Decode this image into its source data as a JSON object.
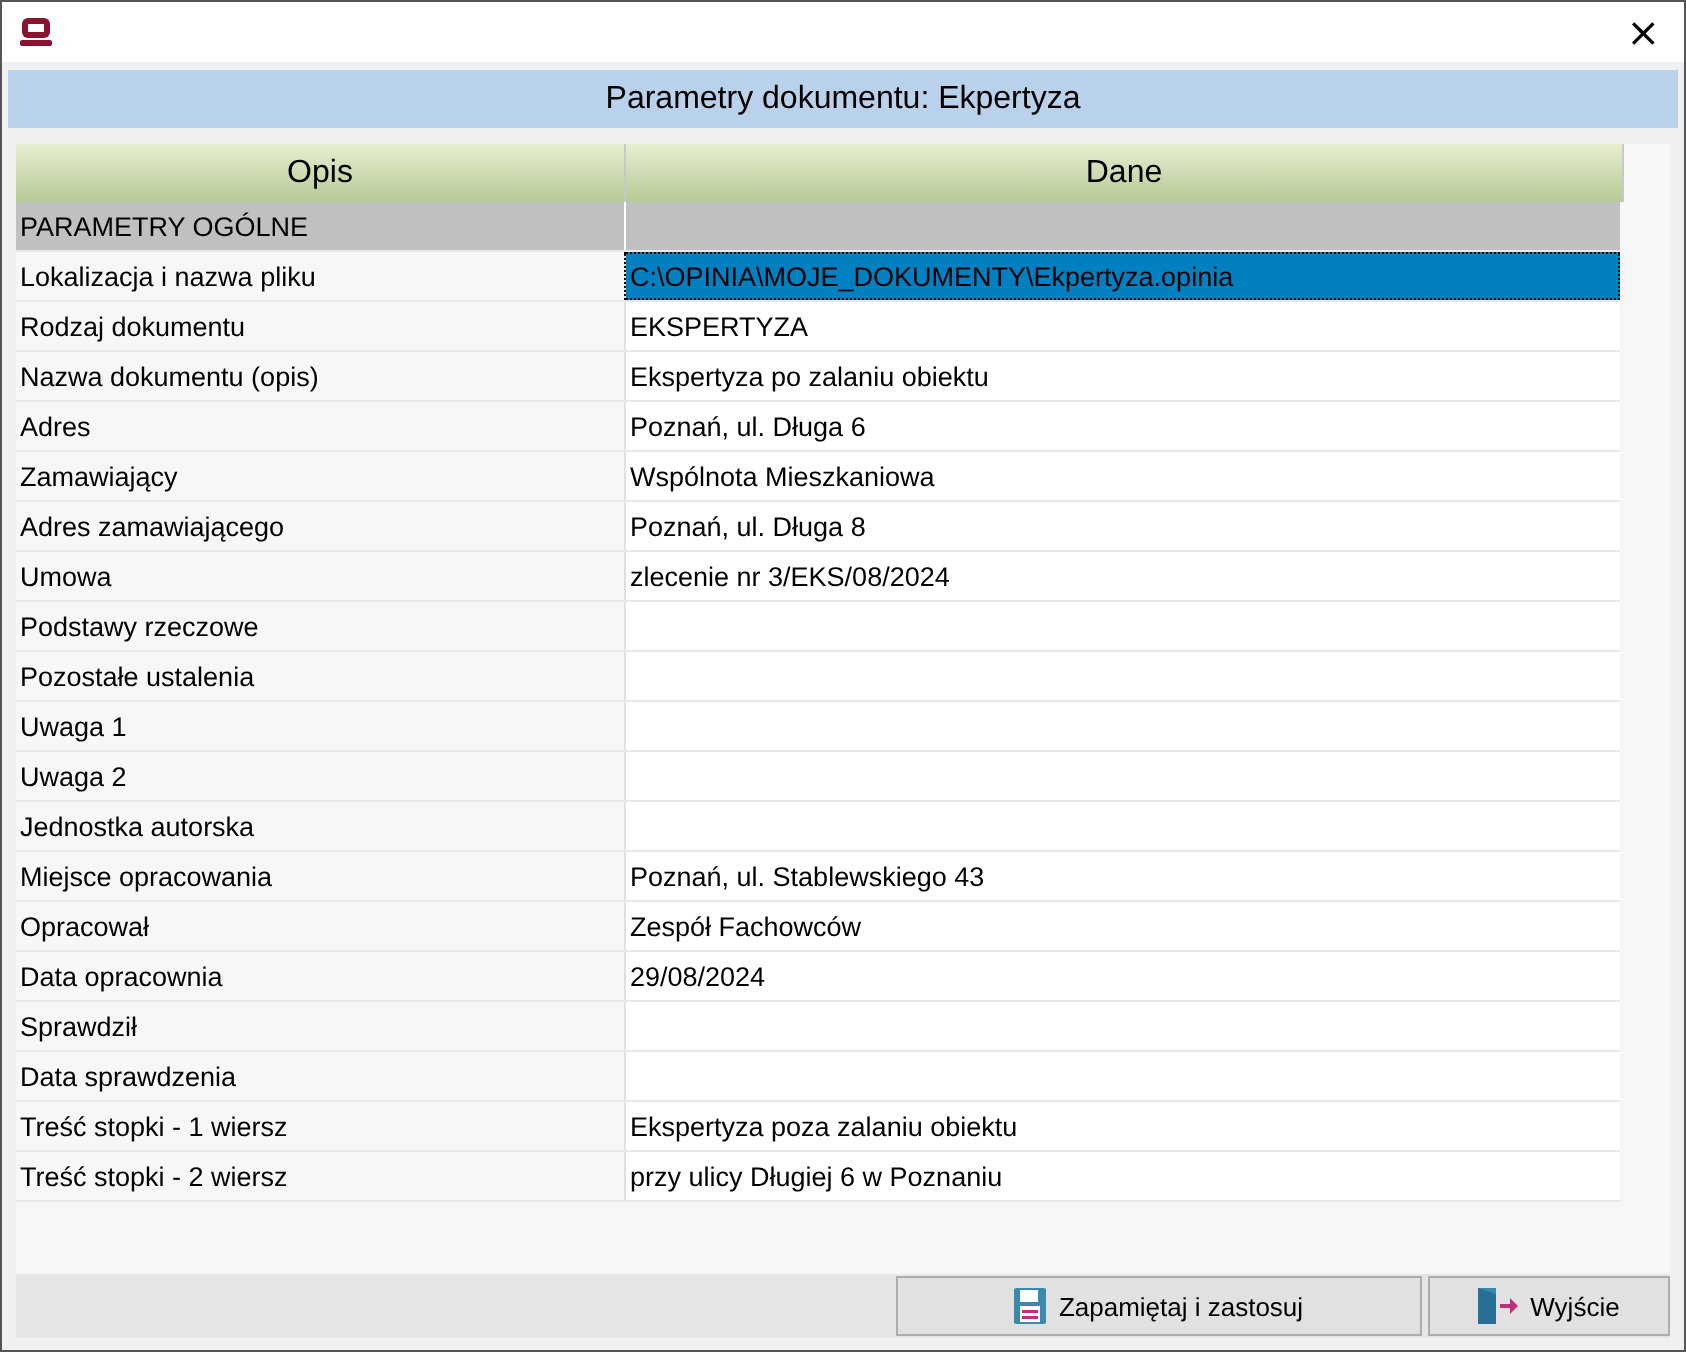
{
  "window": {
    "close": "×"
  },
  "heading": "Parametry dokumentu: Ekpertyza",
  "table": {
    "columns": [
      "Opis",
      "Dane"
    ],
    "rows": [
      {
        "kind": "section",
        "label": "PARAMETRY OGÓLNE"
      },
      {
        "kind": "field",
        "label": "Lokalizacja i nazwa pliku",
        "value": "C:\\OPINIA\\MOJE_DOKUMENTY\\Ekpertyza.opinia",
        "selected": true
      },
      {
        "kind": "field",
        "label": "Rodzaj dokumentu",
        "value": "EKSPERTYZA",
        "selected": false
      },
      {
        "kind": "field",
        "label": "Nazwa dokumentu (opis)",
        "value": "Ekspertyza po zalaniu obiektu",
        "selected": false
      },
      {
        "kind": "field",
        "label": "Adres",
        "value": "Poznań, ul. Długa 6",
        "selected": false
      },
      {
        "kind": "field",
        "label": "Zamawiający",
        "value": "Wspólnota Mieszkaniowa",
        "selected": false
      },
      {
        "kind": "field",
        "label": "Adres zamawiającego",
        "value": "Poznań, ul. Długa 8",
        "selected": false
      },
      {
        "kind": "field",
        "label": "Umowa",
        "value": "zlecenie nr 3/EKS/08/2024",
        "selected": false
      },
      {
        "kind": "field",
        "label": "Podstawy rzeczowe",
        "selected": false
      },
      {
        "kind": "field",
        "label": "Pozostałe ustalenia",
        "selected": false
      },
      {
        "kind": "field",
        "label": "Uwaga 1",
        "selected": false
      },
      {
        "kind": "field",
        "label": "Uwaga 2",
        "selected": false
      },
      {
        "kind": "field",
        "label": "Jednostka autorska",
        "selected": false
      },
      {
        "kind": "field",
        "label": "Miejsce opracowania",
        "value": "Poznań, ul. Stablewskiego 43",
        "selected": false
      },
      {
        "kind": "field",
        "label": "Opracował",
        "value": "Zespół Fachowców",
        "selected": false
      },
      {
        "kind": "field",
        "label": "Data opracownia",
        "value": "29/08/2024",
        "selected": false
      },
      {
        "kind": "field",
        "label": "Sprawdził",
        "selected": false
      },
      {
        "kind": "field",
        "label": "Data sprawdzenia",
        "selected": false
      },
      {
        "kind": "field",
        "label": "Treść stopki - 1 wiersz",
        "value": "Ekspertyza poza zalaniu obiektu",
        "selected": false
      },
      {
        "kind": "field",
        "label": "Treść stopki - 2 wiersz",
        "value": "przy ulicy Długiej 6 w Poznaniu",
        "selected": false
      }
    ]
  },
  "buttons": [
    {
      "kind": "save",
      "label": "Zapamiętaj i zastosuj"
    },
    {
      "kind": "exit",
      "label": "Wyjście"
    }
  ]
}
